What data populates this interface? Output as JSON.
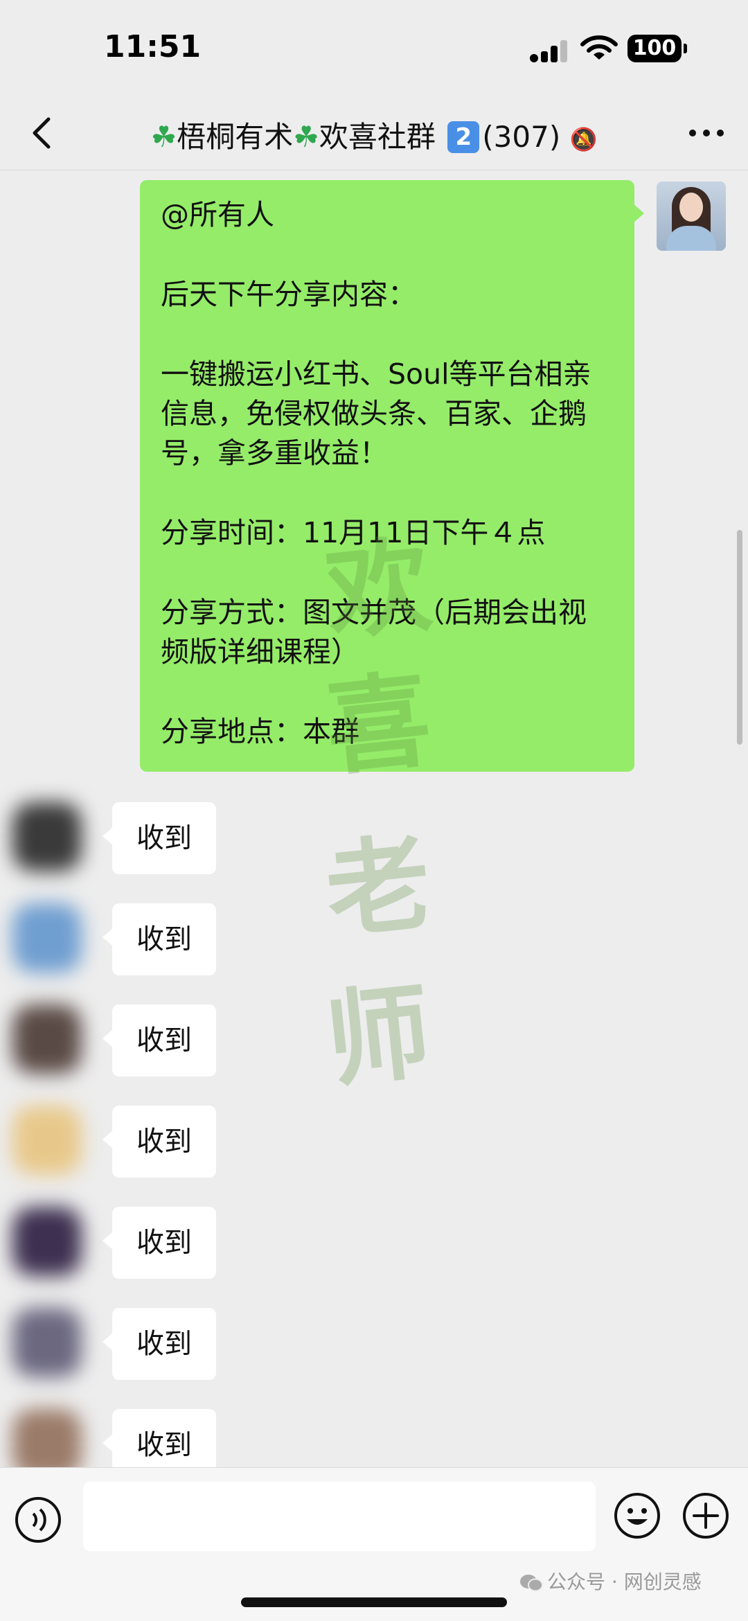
{
  "status_bar": {
    "time": "11:51",
    "battery": "100"
  },
  "nav": {
    "title_a": "梧桐有术",
    "title_b": "欢喜社群",
    "title_badge": "2",
    "title_count": "(307)"
  },
  "message": {
    "lines": [
      "@所有人",
      "后天下午分享内容：",
      "一键搬运小红书、Soul等平台相亲信息，免侵权做头条、百家、企鹅号，拿多重收益！",
      "分享时间：11月11日下午４点",
      "分享方式：图文并茂（后期会出视频版详细课程）",
      "分享地点：本群"
    ]
  },
  "watermark": [
    "欢",
    "喜",
    "老",
    "师"
  ],
  "replies": [
    "收到",
    "收到",
    "收到",
    "收到",
    "收到",
    "收到",
    "收到"
  ],
  "colors": {
    "self_bubble": "#95ec69",
    "background": "#ededed",
    "accent_badge": "#4a8fe6"
  },
  "credit": "公众号 · 网创灵感"
}
